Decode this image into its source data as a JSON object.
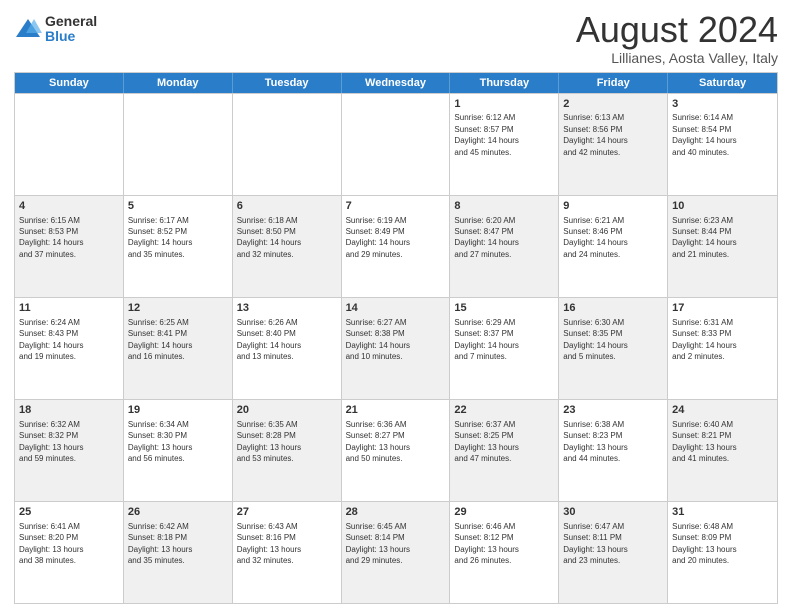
{
  "logo": {
    "general": "General",
    "blue": "Blue"
  },
  "title": "August 2024",
  "location": "Lillianes, Aosta Valley, Italy",
  "header_days": [
    "Sunday",
    "Monday",
    "Tuesday",
    "Wednesday",
    "Thursday",
    "Friday",
    "Saturday"
  ],
  "weeks": [
    [
      {
        "day": "",
        "info": "",
        "shaded": false,
        "empty": true
      },
      {
        "day": "",
        "info": "",
        "shaded": false,
        "empty": true
      },
      {
        "day": "",
        "info": "",
        "shaded": false,
        "empty": true
      },
      {
        "day": "",
        "info": "",
        "shaded": false,
        "empty": true
      },
      {
        "day": "1",
        "info": "Sunrise: 6:12 AM\nSunset: 8:57 PM\nDaylight: 14 hours\nand 45 minutes.",
        "shaded": false,
        "empty": false
      },
      {
        "day": "2",
        "info": "Sunrise: 6:13 AM\nSunset: 8:56 PM\nDaylight: 14 hours\nand 42 minutes.",
        "shaded": true,
        "empty": false
      },
      {
        "day": "3",
        "info": "Sunrise: 6:14 AM\nSunset: 8:54 PM\nDaylight: 14 hours\nand 40 minutes.",
        "shaded": false,
        "empty": false
      }
    ],
    [
      {
        "day": "4",
        "info": "Sunrise: 6:15 AM\nSunset: 8:53 PM\nDaylight: 14 hours\nand 37 minutes.",
        "shaded": true,
        "empty": false
      },
      {
        "day": "5",
        "info": "Sunrise: 6:17 AM\nSunset: 8:52 PM\nDaylight: 14 hours\nand 35 minutes.",
        "shaded": false,
        "empty": false
      },
      {
        "day": "6",
        "info": "Sunrise: 6:18 AM\nSunset: 8:50 PM\nDaylight: 14 hours\nand 32 minutes.",
        "shaded": true,
        "empty": false
      },
      {
        "day": "7",
        "info": "Sunrise: 6:19 AM\nSunset: 8:49 PM\nDaylight: 14 hours\nand 29 minutes.",
        "shaded": false,
        "empty": false
      },
      {
        "day": "8",
        "info": "Sunrise: 6:20 AM\nSunset: 8:47 PM\nDaylight: 14 hours\nand 27 minutes.",
        "shaded": true,
        "empty": false
      },
      {
        "day": "9",
        "info": "Sunrise: 6:21 AM\nSunset: 8:46 PM\nDaylight: 14 hours\nand 24 minutes.",
        "shaded": false,
        "empty": false
      },
      {
        "day": "10",
        "info": "Sunrise: 6:23 AM\nSunset: 8:44 PM\nDaylight: 14 hours\nand 21 minutes.",
        "shaded": true,
        "empty": false
      }
    ],
    [
      {
        "day": "11",
        "info": "Sunrise: 6:24 AM\nSunset: 8:43 PM\nDaylight: 14 hours\nand 19 minutes.",
        "shaded": false,
        "empty": false
      },
      {
        "day": "12",
        "info": "Sunrise: 6:25 AM\nSunset: 8:41 PM\nDaylight: 14 hours\nand 16 minutes.",
        "shaded": true,
        "empty": false
      },
      {
        "day": "13",
        "info": "Sunrise: 6:26 AM\nSunset: 8:40 PM\nDaylight: 14 hours\nand 13 minutes.",
        "shaded": false,
        "empty": false
      },
      {
        "day": "14",
        "info": "Sunrise: 6:27 AM\nSunset: 8:38 PM\nDaylight: 14 hours\nand 10 minutes.",
        "shaded": true,
        "empty": false
      },
      {
        "day": "15",
        "info": "Sunrise: 6:29 AM\nSunset: 8:37 PM\nDaylight: 14 hours\nand 7 minutes.",
        "shaded": false,
        "empty": false
      },
      {
        "day": "16",
        "info": "Sunrise: 6:30 AM\nSunset: 8:35 PM\nDaylight: 14 hours\nand 5 minutes.",
        "shaded": true,
        "empty": false
      },
      {
        "day": "17",
        "info": "Sunrise: 6:31 AM\nSunset: 8:33 PM\nDaylight: 14 hours\nand 2 minutes.",
        "shaded": false,
        "empty": false
      }
    ],
    [
      {
        "day": "18",
        "info": "Sunrise: 6:32 AM\nSunset: 8:32 PM\nDaylight: 13 hours\nand 59 minutes.",
        "shaded": true,
        "empty": false
      },
      {
        "day": "19",
        "info": "Sunrise: 6:34 AM\nSunset: 8:30 PM\nDaylight: 13 hours\nand 56 minutes.",
        "shaded": false,
        "empty": false
      },
      {
        "day": "20",
        "info": "Sunrise: 6:35 AM\nSunset: 8:28 PM\nDaylight: 13 hours\nand 53 minutes.",
        "shaded": true,
        "empty": false
      },
      {
        "day": "21",
        "info": "Sunrise: 6:36 AM\nSunset: 8:27 PM\nDaylight: 13 hours\nand 50 minutes.",
        "shaded": false,
        "empty": false
      },
      {
        "day": "22",
        "info": "Sunrise: 6:37 AM\nSunset: 8:25 PM\nDaylight: 13 hours\nand 47 minutes.",
        "shaded": true,
        "empty": false
      },
      {
        "day": "23",
        "info": "Sunrise: 6:38 AM\nSunset: 8:23 PM\nDaylight: 13 hours\nand 44 minutes.",
        "shaded": false,
        "empty": false
      },
      {
        "day": "24",
        "info": "Sunrise: 6:40 AM\nSunset: 8:21 PM\nDaylight: 13 hours\nand 41 minutes.",
        "shaded": true,
        "empty": false
      }
    ],
    [
      {
        "day": "25",
        "info": "Sunrise: 6:41 AM\nSunset: 8:20 PM\nDaylight: 13 hours\nand 38 minutes.",
        "shaded": false,
        "empty": false
      },
      {
        "day": "26",
        "info": "Sunrise: 6:42 AM\nSunset: 8:18 PM\nDaylight: 13 hours\nand 35 minutes.",
        "shaded": true,
        "empty": false
      },
      {
        "day": "27",
        "info": "Sunrise: 6:43 AM\nSunset: 8:16 PM\nDaylight: 13 hours\nand 32 minutes.",
        "shaded": false,
        "empty": false
      },
      {
        "day": "28",
        "info": "Sunrise: 6:45 AM\nSunset: 8:14 PM\nDaylight: 13 hours\nand 29 minutes.",
        "shaded": true,
        "empty": false
      },
      {
        "day": "29",
        "info": "Sunrise: 6:46 AM\nSunset: 8:12 PM\nDaylight: 13 hours\nand 26 minutes.",
        "shaded": false,
        "empty": false
      },
      {
        "day": "30",
        "info": "Sunrise: 6:47 AM\nSunset: 8:11 PM\nDaylight: 13 hours\nand 23 minutes.",
        "shaded": true,
        "empty": false
      },
      {
        "day": "31",
        "info": "Sunrise: 6:48 AM\nSunset: 8:09 PM\nDaylight: 13 hours\nand 20 minutes.",
        "shaded": false,
        "empty": false
      }
    ]
  ]
}
